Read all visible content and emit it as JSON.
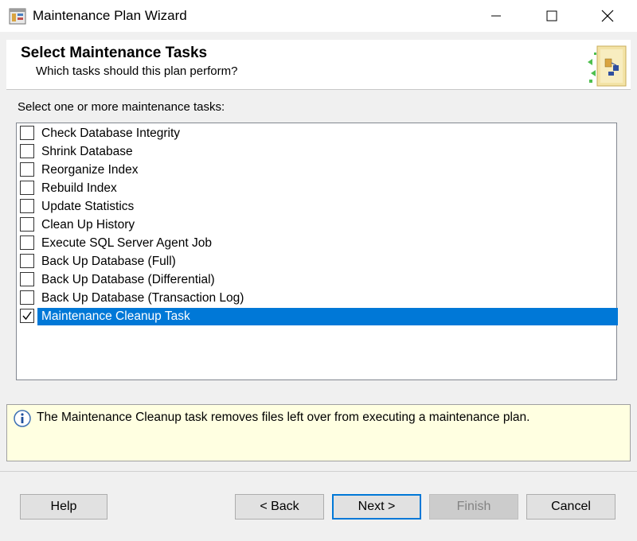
{
  "window": {
    "title": "Maintenance Plan Wizard",
    "icon": "wizard-app-icon",
    "controls": [
      "minimize-icon",
      "maximize-icon",
      "close-icon"
    ]
  },
  "header": {
    "title": "Select Maintenance Tasks",
    "subtitle": "Which tasks should this plan perform?"
  },
  "tasks_label": "Select one or more maintenance tasks:",
  "tasks": [
    {
      "label": "Check Database Integrity",
      "checked": false,
      "selected": false
    },
    {
      "label": "Shrink Database",
      "checked": false,
      "selected": false
    },
    {
      "label": "Reorganize Index",
      "checked": false,
      "selected": false
    },
    {
      "label": "Rebuild Index",
      "checked": false,
      "selected": false
    },
    {
      "label": "Update Statistics",
      "checked": false,
      "selected": false
    },
    {
      "label": "Clean Up History",
      "checked": false,
      "selected": false
    },
    {
      "label": "Execute SQL Server Agent Job",
      "checked": false,
      "selected": false
    },
    {
      "label": "Back Up Database (Full)",
      "checked": false,
      "selected": false
    },
    {
      "label": "Back Up Database (Differential)",
      "checked": false,
      "selected": false
    },
    {
      "label": "Back Up Database (Transaction Log)",
      "checked": false,
      "selected": false
    },
    {
      "label": "Maintenance Cleanup Task",
      "checked": true,
      "selected": true
    }
  ],
  "info": {
    "icon": "info-icon",
    "text": "The Maintenance Cleanup task removes files left over from executing a maintenance plan."
  },
  "buttons": {
    "help": "Help",
    "back": "< Back",
    "next": "Next >",
    "finish": "Finish",
    "cancel": "Cancel"
  },
  "colors": {
    "selection": "#0078d7",
    "info_background": "#ffffe1",
    "default_button_border": "#0078d7"
  }
}
